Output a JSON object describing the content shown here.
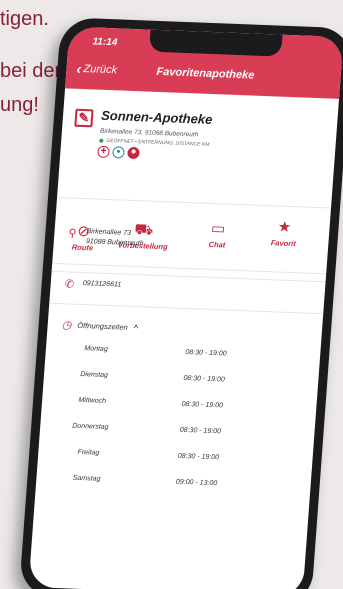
{
  "promo": {
    "line1": "tigen.",
    "line2": "bei der",
    "line3": "ung!"
  },
  "status": {
    "time": "11:14"
  },
  "nav": {
    "back_label": "Zurück",
    "title": "Favoritenapotheke"
  },
  "pharmacy": {
    "name": "Sonnen-Apotheke",
    "address_line": "Birkenallee 73, 91088 Bubenreuth",
    "open_status": "GEÖFFNET • ENTFERNUNG: DISTANCE KM",
    "badges": [
      "pharmacy-cross-icon",
      "chat-icon",
      "settings-gear-icon"
    ]
  },
  "actions": [
    {
      "label": "Route",
      "icon": "route-icon"
    },
    {
      "label": "Vorbestellung",
      "icon": "cart-icon"
    },
    {
      "label": "Chat",
      "icon": "chat-icon"
    },
    {
      "label": "Favorit",
      "icon": "star-icon"
    }
  ],
  "address": {
    "line1": "Birkenallee 73",
    "line2": "91088 Bubenreuth"
  },
  "phone": "0913126611",
  "hours": {
    "title": "Öffnungszeiten",
    "rows": [
      {
        "day": "Montag",
        "time": "08:30 - 19:00"
      },
      {
        "day": "Dienstag",
        "time": "08:30 - 19:00"
      },
      {
        "day": "Mittwoch",
        "time": "08:30 - 19:00"
      },
      {
        "day": "Donnerstag",
        "time": "08:30 - 19:00"
      },
      {
        "day": "Freitag",
        "time": "08:30 - 19:00"
      },
      {
        "day": "Samstag",
        "time": "09:00 - 13:00"
      }
    ]
  },
  "colors": {
    "brand": "#d83d55",
    "accent": "#c7283f",
    "promo_text": "#8a2035"
  }
}
